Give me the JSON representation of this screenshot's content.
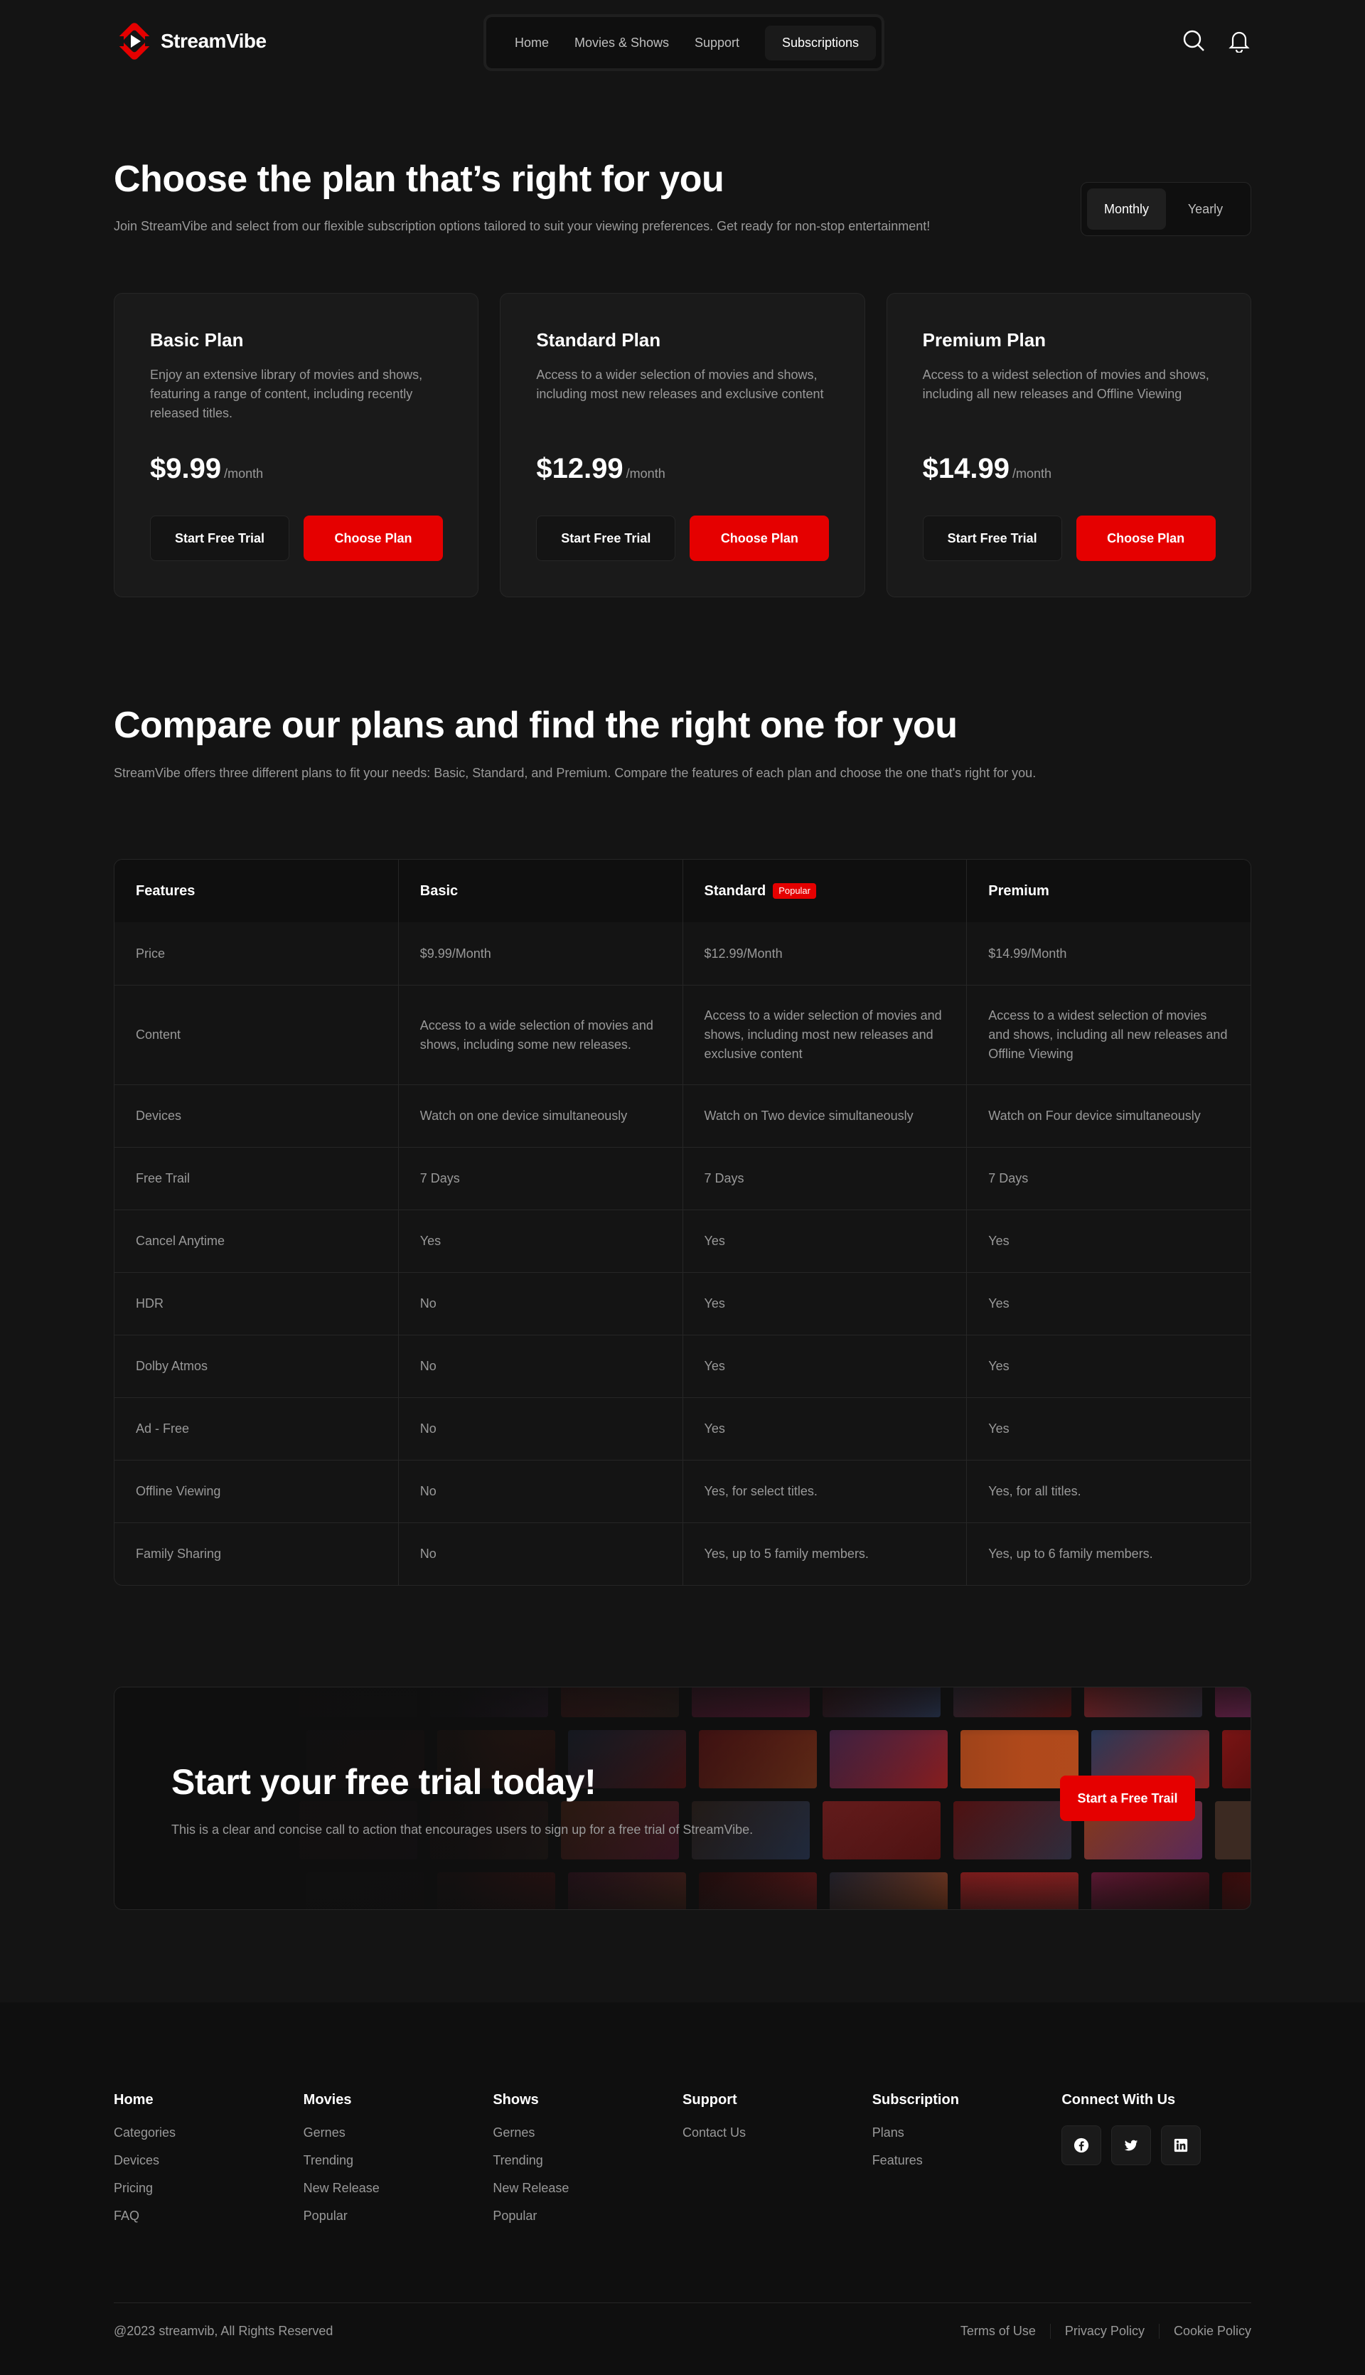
{
  "brand": {
    "name": "StreamVibe",
    "accent": "#e50000"
  },
  "nav": {
    "items": [
      "Home",
      "Movies & Shows",
      "Support",
      "Subscriptions"
    ],
    "active": "Subscriptions"
  },
  "header_icons": [
    "search-icon",
    "bell-icon"
  ],
  "hero": {
    "title": "Choose the plan that’s right for you",
    "subtitle": "Join StreamVibe and select from our flexible subscription options tailored to suit your viewing preferences. Get ready for non-stop entertainment!",
    "toggle": {
      "monthly": "Monthly",
      "yearly": "Yearly",
      "selected": "Monthly"
    }
  },
  "plans": [
    {
      "name": "Basic Plan",
      "desc": "Enjoy an extensive library of movies and shows, featuring a range of content, including recently released titles.",
      "price": "$9.99",
      "per": "/month",
      "trial": "Start Free Trial",
      "choose": "Choose Plan"
    },
    {
      "name": "Standard Plan",
      "desc": "Access to a wider selection of movies and shows, including most new releases and exclusive content",
      "price": "$12.99",
      "per": "/month",
      "trial": "Start Free Trial",
      "choose": "Choose Plan"
    },
    {
      "name": "Premium Plan",
      "desc": "Access to a widest selection of movies and shows, including all new releases and Offline Viewing",
      "price": "$14.99",
      "per": "/month",
      "trial": "Start Free Trial",
      "choose": "Choose Plan"
    }
  ],
  "compare": {
    "title": "Compare our plans and find the right one for you",
    "subtitle": "StreamVibe offers three different plans to fit your needs: Basic, Standard, and Premium. Compare the features of each plan and choose the one that's right for you.",
    "headers": [
      "Features",
      "Basic",
      "Standard",
      "Premium"
    ],
    "popular_badge": "Popular",
    "rows": [
      [
        "Price",
        "$9.99/Month",
        "$12.99/Month",
        "$14.99/Month"
      ],
      [
        "Content",
        "Access to a wide selection of movies and shows, including some new releases.",
        "Access to a wider selection of movies and shows, including most new releases and exclusive content",
        "Access to a widest selection of movies and shows, including all new releases and Offline Viewing"
      ],
      [
        "Devices",
        "Watch on one device simultaneously",
        "Watch on Two device simultaneously",
        "Watch on Four device simultaneously"
      ],
      [
        "Free Trail",
        "7 Days",
        "7 Days",
        "7 Days"
      ],
      [
        "Cancel Anytime",
        "Yes",
        "Yes",
        "Yes"
      ],
      [
        "HDR",
        "No",
        "Yes",
        "Yes"
      ],
      [
        "Dolby Atmos",
        "No",
        "Yes",
        "Yes"
      ],
      [
        "Ad - Free",
        "No",
        "Yes",
        "Yes"
      ],
      [
        "Offline Viewing",
        "No",
        "Yes, for select titles.",
        "Yes, for all titles."
      ],
      [
        "Family Sharing",
        "No",
        "Yes, up to 5 family members.",
        "Yes, up to 6 family members."
      ]
    ]
  },
  "cta": {
    "title": "Start your free trial today!",
    "subtitle": "This is a clear and concise call to action that encourages users to sign up for a free trial of StreamVibe.",
    "button": "Start a Free Trail"
  },
  "footer": {
    "columns": [
      {
        "title": "Home",
        "links": [
          "Categories",
          "Devices",
          "Pricing",
          "FAQ"
        ]
      },
      {
        "title": "Movies",
        "links": [
          "Gernes",
          "Trending",
          "New Release",
          "Popular"
        ]
      },
      {
        "title": "Shows",
        "links": [
          "Gernes",
          "Trending",
          "New Release",
          "Popular"
        ]
      },
      {
        "title": "Support",
        "links": [
          "Contact Us"
        ]
      },
      {
        "title": "Subscription",
        "links": [
          "Plans",
          "Features"
        ]
      }
    ],
    "connect_title": "Connect With Us",
    "socials": [
      "facebook-icon",
      "twitter-icon",
      "linkedin-icon"
    ],
    "copyright": "@2023 streamvib, All Rights Reserved",
    "legal": [
      "Terms of Use",
      "Privacy Policy",
      "Cookie Policy"
    ]
  }
}
